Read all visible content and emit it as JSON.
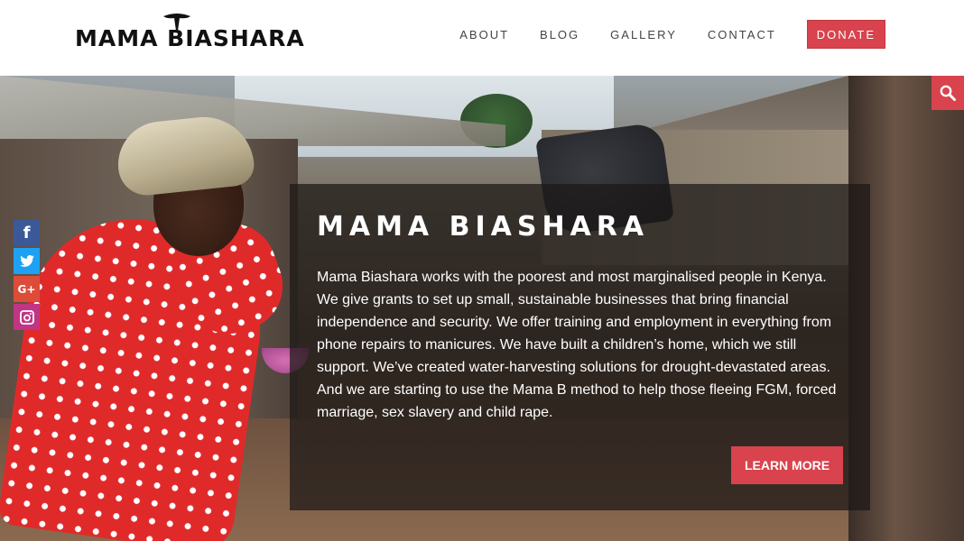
{
  "header": {
    "logo_text": "MAMA BIASHARA",
    "nav": [
      {
        "label": "ABOUT"
      },
      {
        "label": "BLOG"
      },
      {
        "label": "GALLERY"
      },
      {
        "label": "CONTACT"
      }
    ],
    "donate_label": "DONATE"
  },
  "hero": {
    "title": "MAMA BIASHARA",
    "body": "Mama Biashara works with the poorest and most marginalised people in Kenya. We give grants to set up small, sustainable businesses that bring financial independence and security. We offer training and employment in everything from phone repairs to manicures. We have built a children’s home, which we still support. We’ve created water-harvesting solutions for drought-devastated areas. And we are starting to use the Mama B method to help those fleeing FGM, forced marriage, sex slavery and child rape.",
    "cta_label": "LEARN MORE"
  },
  "social": [
    {
      "name": "facebook-icon",
      "glyph": "f"
    },
    {
      "name": "twitter-icon",
      "glyph": "t"
    },
    {
      "name": "google-plus-icon",
      "glyph": "G+"
    },
    {
      "name": "instagram-icon",
      "glyph": "◎"
    }
  ],
  "colors": {
    "accent": "#d9434e",
    "facebook": "#3b5998",
    "twitter": "#1da1f2",
    "googleplus": "#dd4b39",
    "instagram": "#c13584"
  },
  "icons": {
    "search": "search-icon"
  }
}
